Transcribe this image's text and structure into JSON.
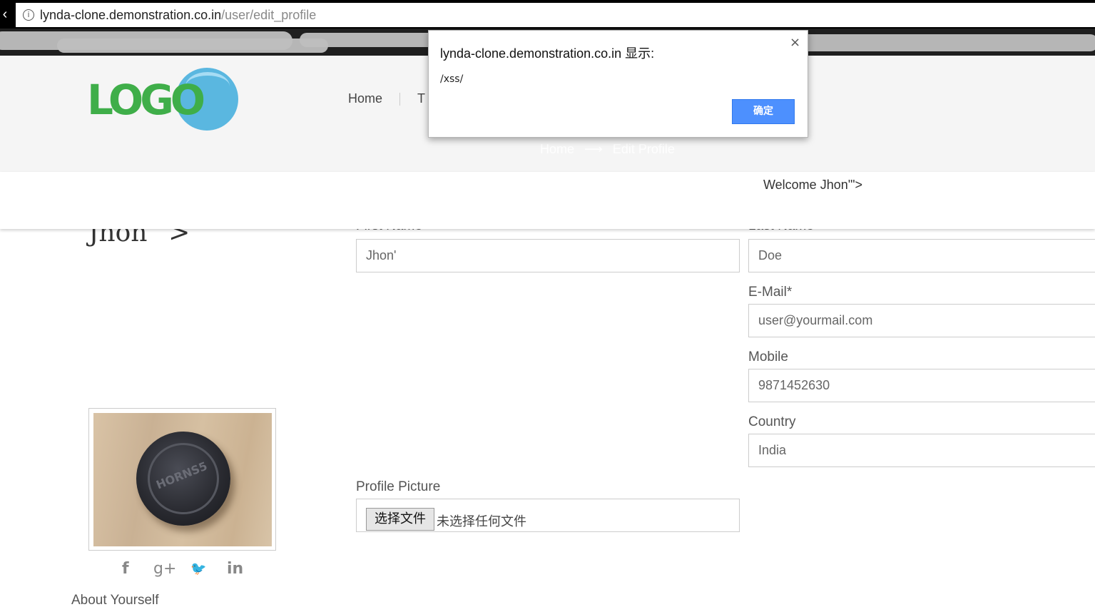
{
  "browser": {
    "url_host": "lynda-clone.demonstration.co.in",
    "url_path": "/user/edit_profile",
    "back_glyph": "‹",
    "info_glyph": "i"
  },
  "header": {
    "logo_text": "LOGO",
    "nav": [
      "Home",
      "T"
    ],
    "breadcrumb": {
      "home": "Home",
      "arrow": "⟶",
      "current": "Edit Profile"
    }
  },
  "welcome": "Welcome Jhon'\">",
  "profile": {
    "display_name": "Jhon'''>",
    "lid_text": "HORNS5",
    "about_label": "About Yourself",
    "social_icons": [
      "facebook-icon",
      "google-plus-icon",
      "twitter-icon",
      "linkedin-icon"
    ],
    "social_glyphs": {
      "facebook": "f",
      "google_plus": "g+",
      "twitter": "🐦",
      "linkedin": "in"
    }
  },
  "form": {
    "first_name_label": "First Name",
    "first_name": "Jhon'",
    "last_name_label": "Last Name",
    "last_name": "Doe",
    "email_label": "E-Mail*",
    "email": "user@yourmail.com",
    "mobile_label": "Mobile",
    "mobile": "9871452630",
    "country_label": "Country",
    "country": "India",
    "picture_label": "Profile Picture",
    "file_button": "选择文件",
    "file_status": "未选择任何文件"
  },
  "alert": {
    "title": "lynda-clone.demonstration.co.in 显示:",
    "message": "/xss/",
    "ok": "确定",
    "close": "×"
  },
  "colors": {
    "logo_green": "#3fae49",
    "logo_blue": "#5ab7e0",
    "ok_button": "#4d90fe"
  }
}
